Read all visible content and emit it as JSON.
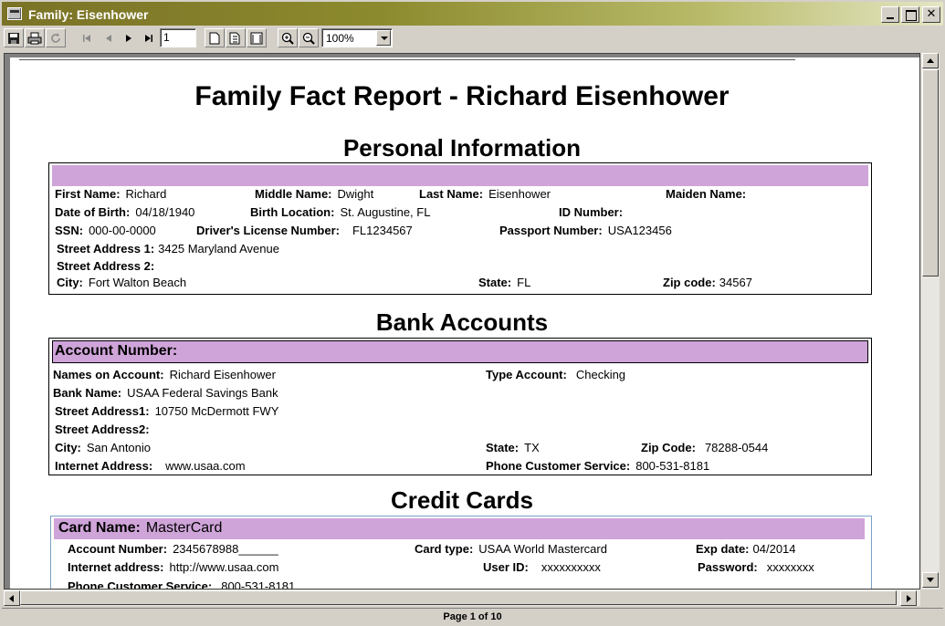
{
  "window": {
    "title": "Family: Eisenhower",
    "icons": {
      "app": "app-icon",
      "minimize": "minimize-icon",
      "maximize": "maximize-icon",
      "close": "close-icon"
    }
  },
  "toolbar": {
    "page_value": "1",
    "zoom_value": "100%",
    "icons": [
      "save-icon",
      "print-icon",
      "refresh-icon",
      "first-page-icon",
      "prev-page-icon",
      "next-page-icon",
      "last-page-icon",
      "single-page-icon",
      "multi-page-icon",
      "page-width-icon",
      "zoom-in-icon",
      "zoom-out-icon",
      "chevron-down-icon"
    ]
  },
  "report": {
    "title": "Family Fact Report - Richard Eisenhower",
    "personal": {
      "heading": "Personal Information",
      "first_name_label": "First Name:",
      "first_name": "Richard",
      "middle_name_label": "Middle Name:",
      "middle_name": "Dwight",
      "last_name_label": "Last Name:",
      "last_name": "Eisenhower",
      "maiden_name_label": "Maiden Name:",
      "dob_label": "Date of Birth:",
      "dob": "04/18/1940",
      "birth_location_label": "Birth Location:",
      "birth_location": "St. Augustine, FL",
      "id_number_label": "ID Number:",
      "ssn_label": "SSN:",
      "ssn": "000-00-0000",
      "license_label": "Driver's License Number:",
      "license": "FL1234567",
      "passport_label": "Passport Number:",
      "passport": "USA123456",
      "street1_label": "Street Address 1:",
      "street1": "3425 Maryland Avenue",
      "street2_label": "Street Address 2:",
      "city_label": "City:",
      "city": "Fort Walton Beach",
      "state_label": "State:",
      "state": "FL",
      "zip_label": "Zip code:",
      "zip": "34567"
    },
    "bank": {
      "heading": "Bank Accounts",
      "account_number_label": "Account Number:",
      "names_label": "Names on Account:",
      "names": "Richard Eisenhower",
      "type_label": "Type Account:",
      "type": "Checking",
      "bank_name_label": "Bank Name:",
      "bank_name": "USAA Federal Savings Bank",
      "street1_label": "Street Address1:",
      "street1": "10750 McDermott FWY",
      "street2_label": "Street Address2:",
      "city_label": "City:",
      "city": "San Antonio",
      "state_label": "State:",
      "state": "TX",
      "zip_label": "Zip Code:",
      "zip": "78288-0544",
      "internet_label": "Internet Address:",
      "internet": "www.usaa.com",
      "phone_label": "Phone Customer Service:",
      "phone": "800-531-8181"
    },
    "credit": {
      "heading": "Credit Cards",
      "card_name_label": "Card Name:",
      "card_name": "MasterCard",
      "account_label": "Account Number:",
      "account": "2345678988______",
      "card_type_label": "Card type:",
      "card_type": "USAA World Mastercard",
      "exp_label": "Exp date:",
      "exp": "04/2014",
      "internet_label": "Internet address:",
      "internet": "http://www.usaa.com",
      "user_id_label": "User ID:",
      "user_id": "xxxxxxxxxx",
      "password_label": "Password:",
      "password": "xxxxxxxx",
      "phone_label": "Phone Customer Service:",
      "phone": "800-531-8181"
    },
    "colors": {
      "band": "#cfa4d9",
      "titlebar_start": "#7a7226"
    }
  },
  "status": {
    "page_indicator": "Page 1 of 10"
  }
}
